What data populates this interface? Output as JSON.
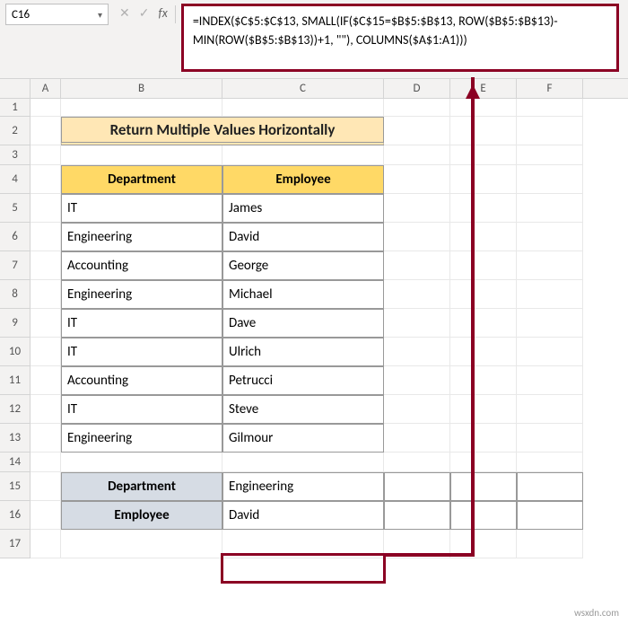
{
  "nameBox": "C16",
  "formula": "=INDEX($C$5:$C$13, SMALL(IF($C$15=$B$5:$B$13, ROW($B$5:$B$13)-MIN(ROW($B$5:$B$13))+1, \"\"), COLUMNS($A$1:A1)))",
  "columns": [
    "A",
    "B",
    "C",
    "D",
    "E",
    "F"
  ],
  "rowNumbers": [
    "1",
    "2",
    "3",
    "4",
    "5",
    "6",
    "7",
    "8",
    "9",
    "10",
    "11",
    "12",
    "13",
    "14",
    "15",
    "16",
    "17"
  ],
  "title": "Return Multiple Values Horizontally",
  "headers": {
    "department": "Department",
    "employee": "Employee"
  },
  "data": [
    {
      "dept": "IT",
      "emp": "James"
    },
    {
      "dept": "Engineering",
      "emp": "David"
    },
    {
      "dept": "Accounting",
      "emp": "George"
    },
    {
      "dept": "Engineering",
      "emp": "Michael"
    },
    {
      "dept": "IT",
      "emp": "Dave"
    },
    {
      "dept": "IT",
      "emp": "Ulrich"
    },
    {
      "dept": "Accounting",
      "emp": "Petrucci"
    },
    {
      "dept": "IT",
      "emp": "Steve"
    },
    {
      "dept": "Engineering",
      "emp": "Gilmour"
    }
  ],
  "lookup": {
    "departmentLabel": "Department",
    "employeeLabel": "Employee",
    "departmentValue": "Engineering",
    "employeeValue": "David"
  },
  "fxLabel": "fx",
  "watermark": "wsxdn.com"
}
